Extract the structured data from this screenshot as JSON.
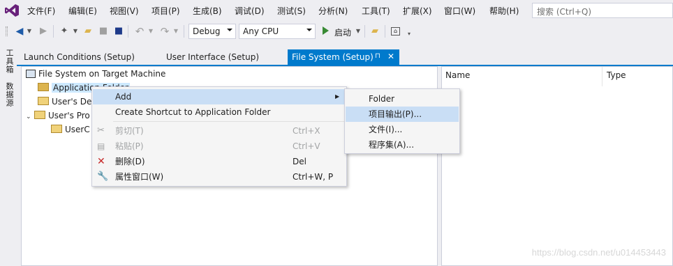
{
  "menubar": {
    "items": [
      "文件(F)",
      "编辑(E)",
      "视图(V)",
      "项目(P)",
      "生成(B)",
      "调试(D)",
      "测试(S)",
      "分析(N)",
      "工具(T)",
      "扩展(X)",
      "窗口(W)",
      "帮助(H)"
    ],
    "search_placeholder": "搜索 (Ctrl+Q)"
  },
  "toolbar": {
    "config": "Debug",
    "platform": "Any CPU",
    "start_label": "启动"
  },
  "left_strip": {
    "toolbox": "工具箱",
    "datasources": "数据源"
  },
  "tabs": {
    "launch_conditions": "Launch Conditions (Setup)",
    "user_interface": "User Interface (Setup)",
    "file_system": "File System (Setup)",
    "pin": "⊓",
    "close": "✕"
  },
  "tree": {
    "root": "File System on Target Machine",
    "app_folder": "Application Folder",
    "users_desktop": "User's De",
    "users_programs": "User's Pro",
    "userc": "UserC"
  },
  "list_headers": {
    "name": "Name",
    "type": "Type"
  },
  "context_menu": {
    "add": "Add",
    "create_shortcut": "Create Shortcut to Application Folder",
    "cut": "剪切(T)",
    "cut_shortcut": "Ctrl+X",
    "paste": "粘贴(P)",
    "paste_shortcut": "Ctrl+V",
    "delete": "删除(D)",
    "delete_shortcut": "Del",
    "properties": "属性窗口(W)",
    "properties_shortcut": "Ctrl+W, P"
  },
  "submenu": {
    "folder": "Folder",
    "project_output": "项目输出(P)...",
    "file": "文件(I)...",
    "assembly": "程序集(A)..."
  },
  "watermark": "https://blog.csdn.net/u014453443",
  "colors": {
    "accent": "#007acc",
    "highlight": "#c9def5",
    "vs_purple": "#68217a",
    "delete_red": "#c62828",
    "start_green": "#388a34"
  }
}
